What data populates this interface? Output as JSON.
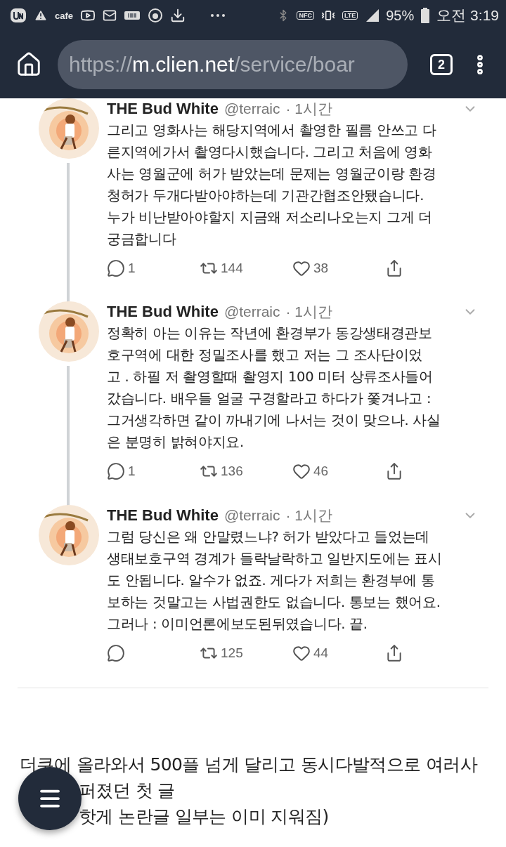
{
  "status_bar": {
    "carrier_label": "cafe",
    "nfc_label": "NFC",
    "network_label": "LTE",
    "battery": "95%",
    "time": "오전 3:19"
  },
  "browser": {
    "url": {
      "scheme": "https://",
      "host": "m.clien.net",
      "path": "/service/boar"
    },
    "tab_count": "2"
  },
  "tweets": [
    {
      "name": "THE Bud White",
      "handle": "@terraic",
      "time": "· 1시간",
      "lines": [
        "그리고 영화사는 해당지역에서 촬영한 필름 안쓰고 다",
        "른지역에가서 촬영다시했습니다. 그리고 처음에 영화",
        "사는 영월군에 허가 받았는데 문제는 영월군이랑 환경",
        "청허가 두개다받아야하는데 기관간협조안됐습니다.",
        "누가 비난받아야할지 지금왜 저소리나오는지 그게 더",
        "궁금합니다"
      ],
      "replies": "1",
      "retweets": "144",
      "likes": "38",
      "thread": true
    },
    {
      "name": "THE Bud White",
      "handle": "@terraic",
      "time": "· 1시간",
      "lines": [
        "정확히 아는 이유는 작년에 환경부가 동강생태경관보",
        "호구역에 대한 정밀조사를 했고 저는 그 조사단이었",
        "고 . 하필 저 촬영할때 촬영지 100 미터 상류조사들어",
        "갔습니다. 배우들 얼굴 구경할라고 하다가 쫓겨나고 :",
        "그거생각하면 같이 까내기에 나서는 것이 맞으나. 사실",
        "은 분명히 밝혀야지요."
      ],
      "replies": "1",
      "retweets": "136",
      "likes": "46",
      "thread": true
    },
    {
      "name": "THE Bud White",
      "handle": "@terraic",
      "time": "· 1시간",
      "lines": [
        "그럼 당신은 왜 안말렸느냐? 허가 받았다고 들었는데",
        "생태보호구역 경계가 들락날락하고 일반지도에는 표시",
        "도 안됩니다. 알수가 없죠. 게다가 저희는 환경부에 통",
        "보하는 것말고는 사법권한도 없습니다. 통보는 했어요.",
        "그러나 : 이미언론에보도된뒤였습니다. 끝."
      ],
      "retweets": "125",
      "likes": "44",
      "thread": false
    }
  ],
  "post_lines": [
    {
      "text": "더쿠에 올라와서 500플 넘게 달리고 동시다발적으로 여러사",
      "covered": false
    },
    {
      "text": "퍼졌던 첫 글",
      "covered": true
    },
    {
      "text": "핫게 논란글 일부는 이미 지워짐)",
      "covered": true
    }
  ]
}
